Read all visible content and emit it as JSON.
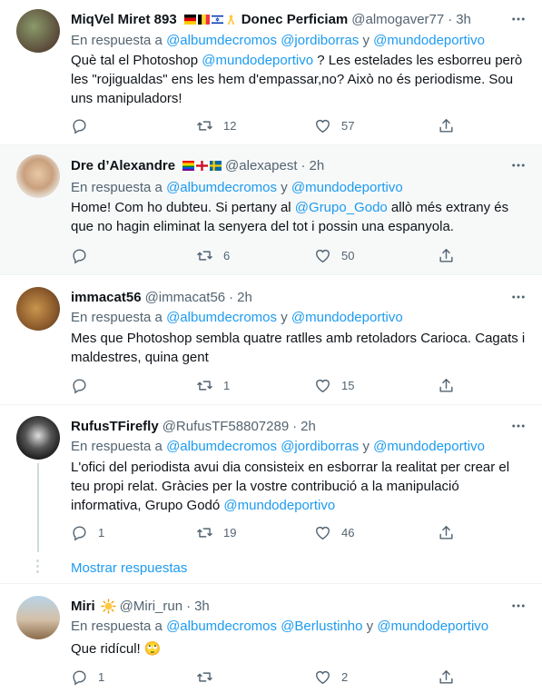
{
  "reply_prefix": "En respuesta a",
  "reply_and": "y",
  "show_replies": "Mostrar respuestas",
  "tweets": [
    {
      "name": "MiqVel Miret 893",
      "name_suffix": "Donec Perficiam",
      "handle": "@almogaver77",
      "time": "3h",
      "replying": [
        "@albumdecromos",
        "@jordiborras",
        "@mundodeportivo"
      ],
      "text_a": "Què tal el Photoshop ",
      "text_link": "@mundodeportivo",
      "text_b": " ? Les estelades les esborreu però les \"rojigualdas\" ens les hem d'empassar,no? Això no és periodisme. Sou uns manipuladors!",
      "retweets": "12",
      "likes": "57"
    },
    {
      "name": "Dre d’Alexandre",
      "handle": "@alexapest",
      "time": "2h",
      "replying": [
        "@albumdecromos",
        "@mundodeportivo"
      ],
      "text_a": "Home! Com ho dubteu. Si pertany al ",
      "text_link": "@Grupo_Godo",
      "text_b": " allò més extrany és que no hagin eliminat la senyera del tot i possin una espanyola.",
      "retweets": "6",
      "likes": "50"
    },
    {
      "name": "immacat56",
      "handle": "@immacat56",
      "time": "2h",
      "replying": [
        "@albumdecromos",
        "@mundodeportivo"
      ],
      "text": "Mes que Photoshop sembla quatre ratlles amb retoladors Carioca. Cagats i maldestres, quina gent",
      "retweets": "1",
      "likes": "15"
    },
    {
      "name": "RufusTFirefly",
      "handle": "@RufusTF58807289",
      "time": "2h",
      "replying": [
        "@albumdecromos",
        "@jordiborras",
        "@mundodeportivo"
      ],
      "text_a": "L'ofici del periodista avui dia consisteix en esborrar la realitat per crear el teu propi relat. Gràcies per la vostre contribució a la manipulació informativa, Grupo Godó ",
      "text_link": "@mundodeportivo",
      "replies": "1",
      "retweets": "19",
      "likes": "46"
    },
    {
      "name": "Miri",
      "handle": "@Miri_run",
      "time": "3h",
      "replying": [
        "@albumdecromos",
        "@Berlustinho",
        "@mundodeportivo"
      ],
      "text": "Que ridícul! 🙄",
      "replies": "1",
      "likes": "2"
    }
  ],
  "colors": {
    "accent": "#1d9bf0",
    "secondary": "#536471",
    "highlight_bg": "#f7f9f9"
  },
  "icons": [
    "reply-icon",
    "retweet-icon",
    "like-icon",
    "share-icon",
    "more-icon"
  ]
}
